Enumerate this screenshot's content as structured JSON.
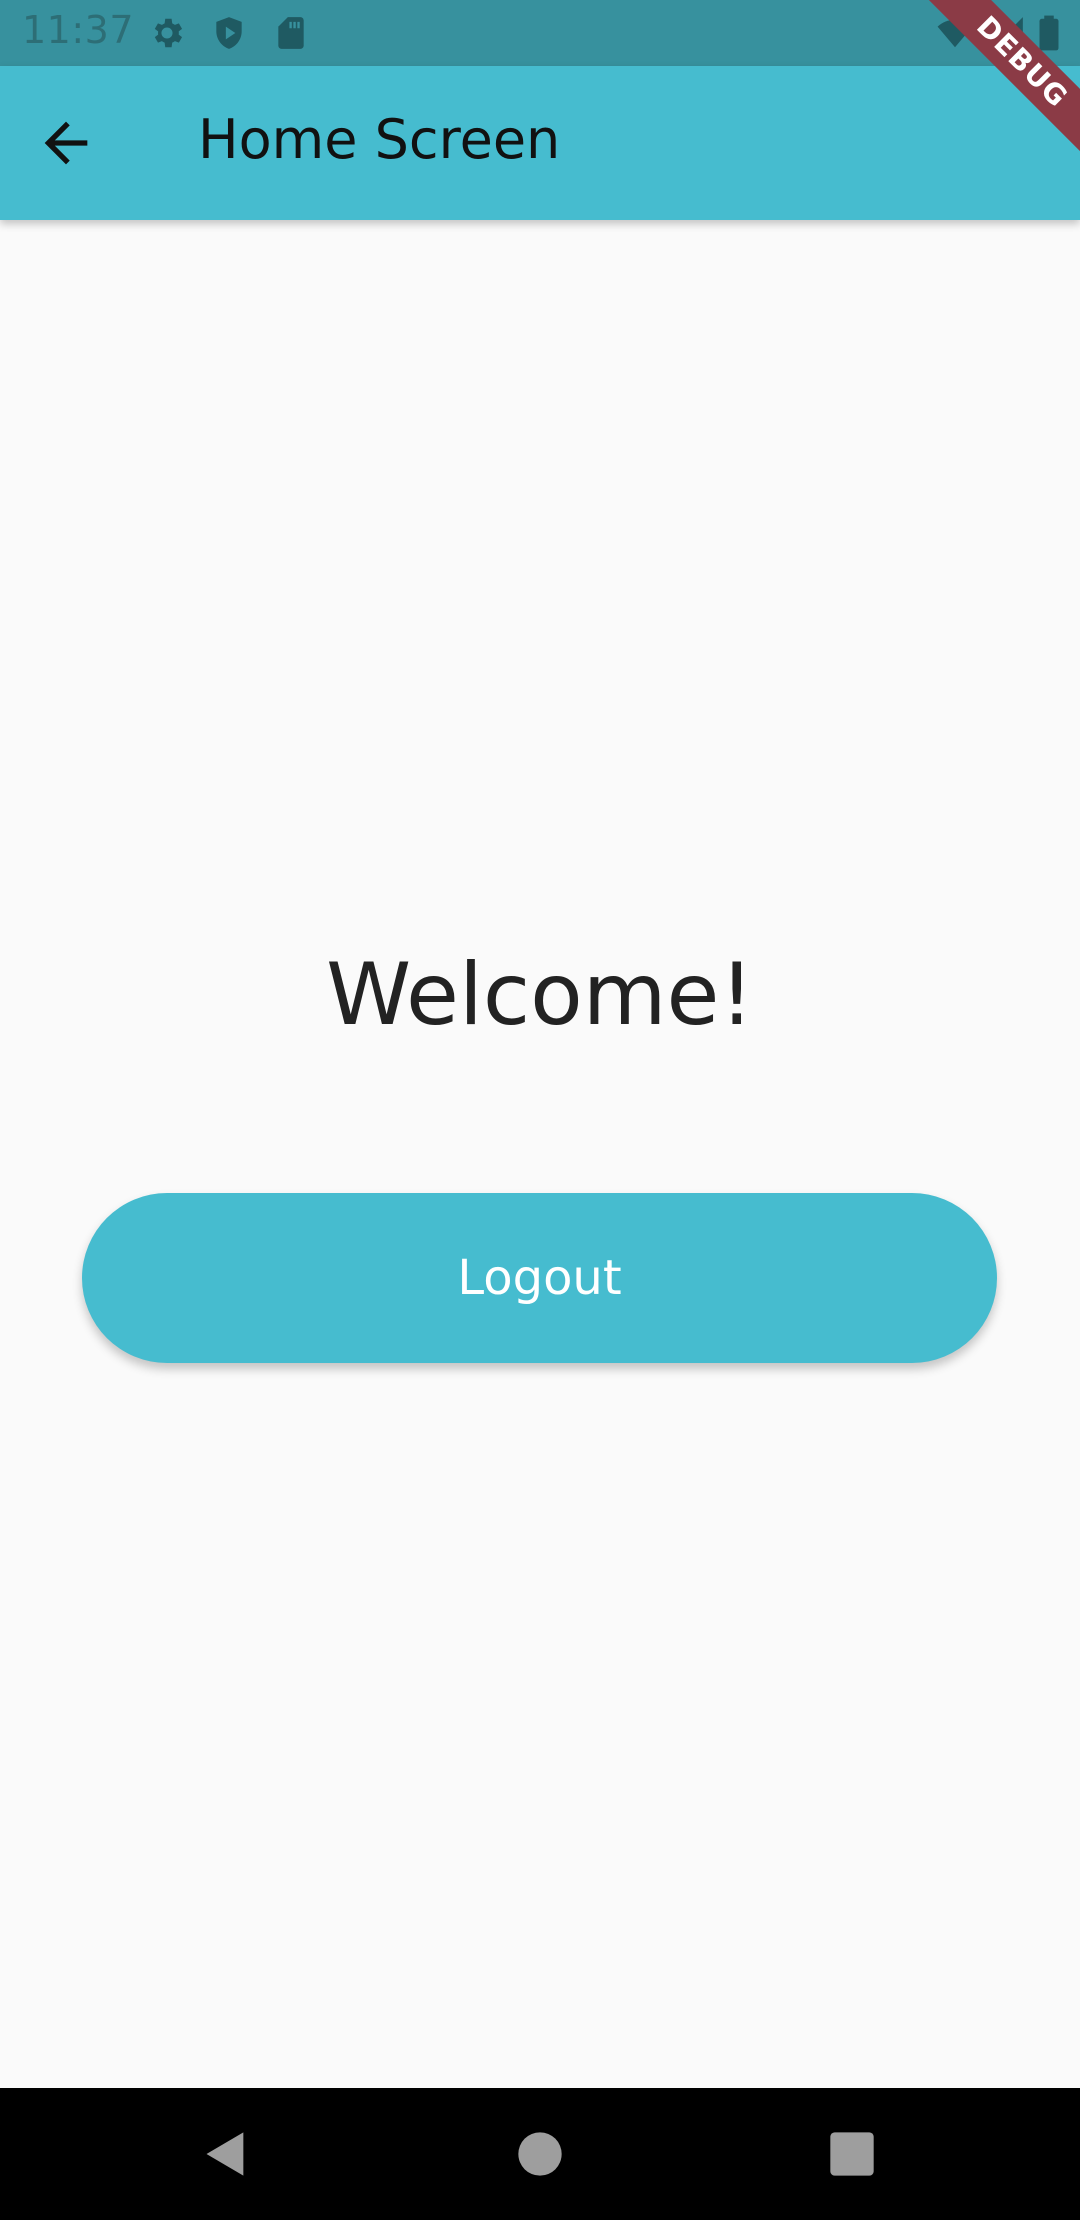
{
  "status_bar": {
    "time": "11:37",
    "background": "#37919E",
    "icons_left": [
      "settings-gear",
      "shield-play",
      "sd-card"
    ],
    "icons_right": [
      "wifi",
      "cellular-signal",
      "battery"
    ]
  },
  "debug_banner": {
    "label": "DEBUG",
    "color": "#8B3B46"
  },
  "app_bar": {
    "title": "Home Screen",
    "background": "#46BCCF",
    "back_icon": "arrow-left"
  },
  "main": {
    "welcome_text": "Welcome!",
    "logout_label": "Logout",
    "accent": "#46BCCF",
    "background": "#FAFAFA"
  },
  "nav_bar": {
    "buttons": [
      "back-triangle",
      "home-circle",
      "recents-square"
    ]
  }
}
